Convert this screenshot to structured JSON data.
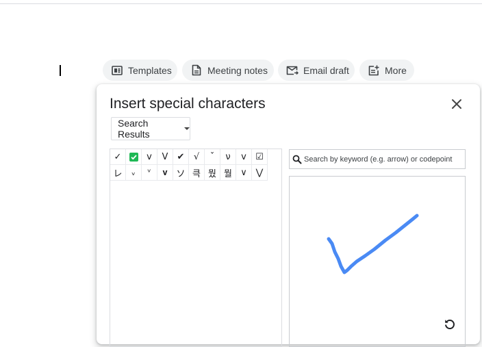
{
  "chips": [
    {
      "label": "Templates",
      "icon": "template-icon"
    },
    {
      "label": "Meeting notes",
      "icon": "document-icon"
    },
    {
      "label": "Email draft",
      "icon": "email-icon"
    },
    {
      "label": "More",
      "icon": "note-add-icon"
    }
  ],
  "dialog": {
    "title": "Insert special characters",
    "dropdown_label": "Search Results",
    "search_placeholder": "Search by keyword (e.g. arrow) or codepoint",
    "results": [
      "✓",
      "✅",
      "v",
      "V",
      "✔",
      "√",
      "ˇ",
      "ν",
      "ᴠ",
      "☑",
      "レ",
      "ᵥ",
      "ᵛ",
      "𝐯",
      "ソ",
      "큭",
      "뭤",
      "뭘",
      "∨",
      "⋁"
    ]
  },
  "colors": {
    "stroke": "#4a8af4",
    "check_green": "#1fb855"
  }
}
